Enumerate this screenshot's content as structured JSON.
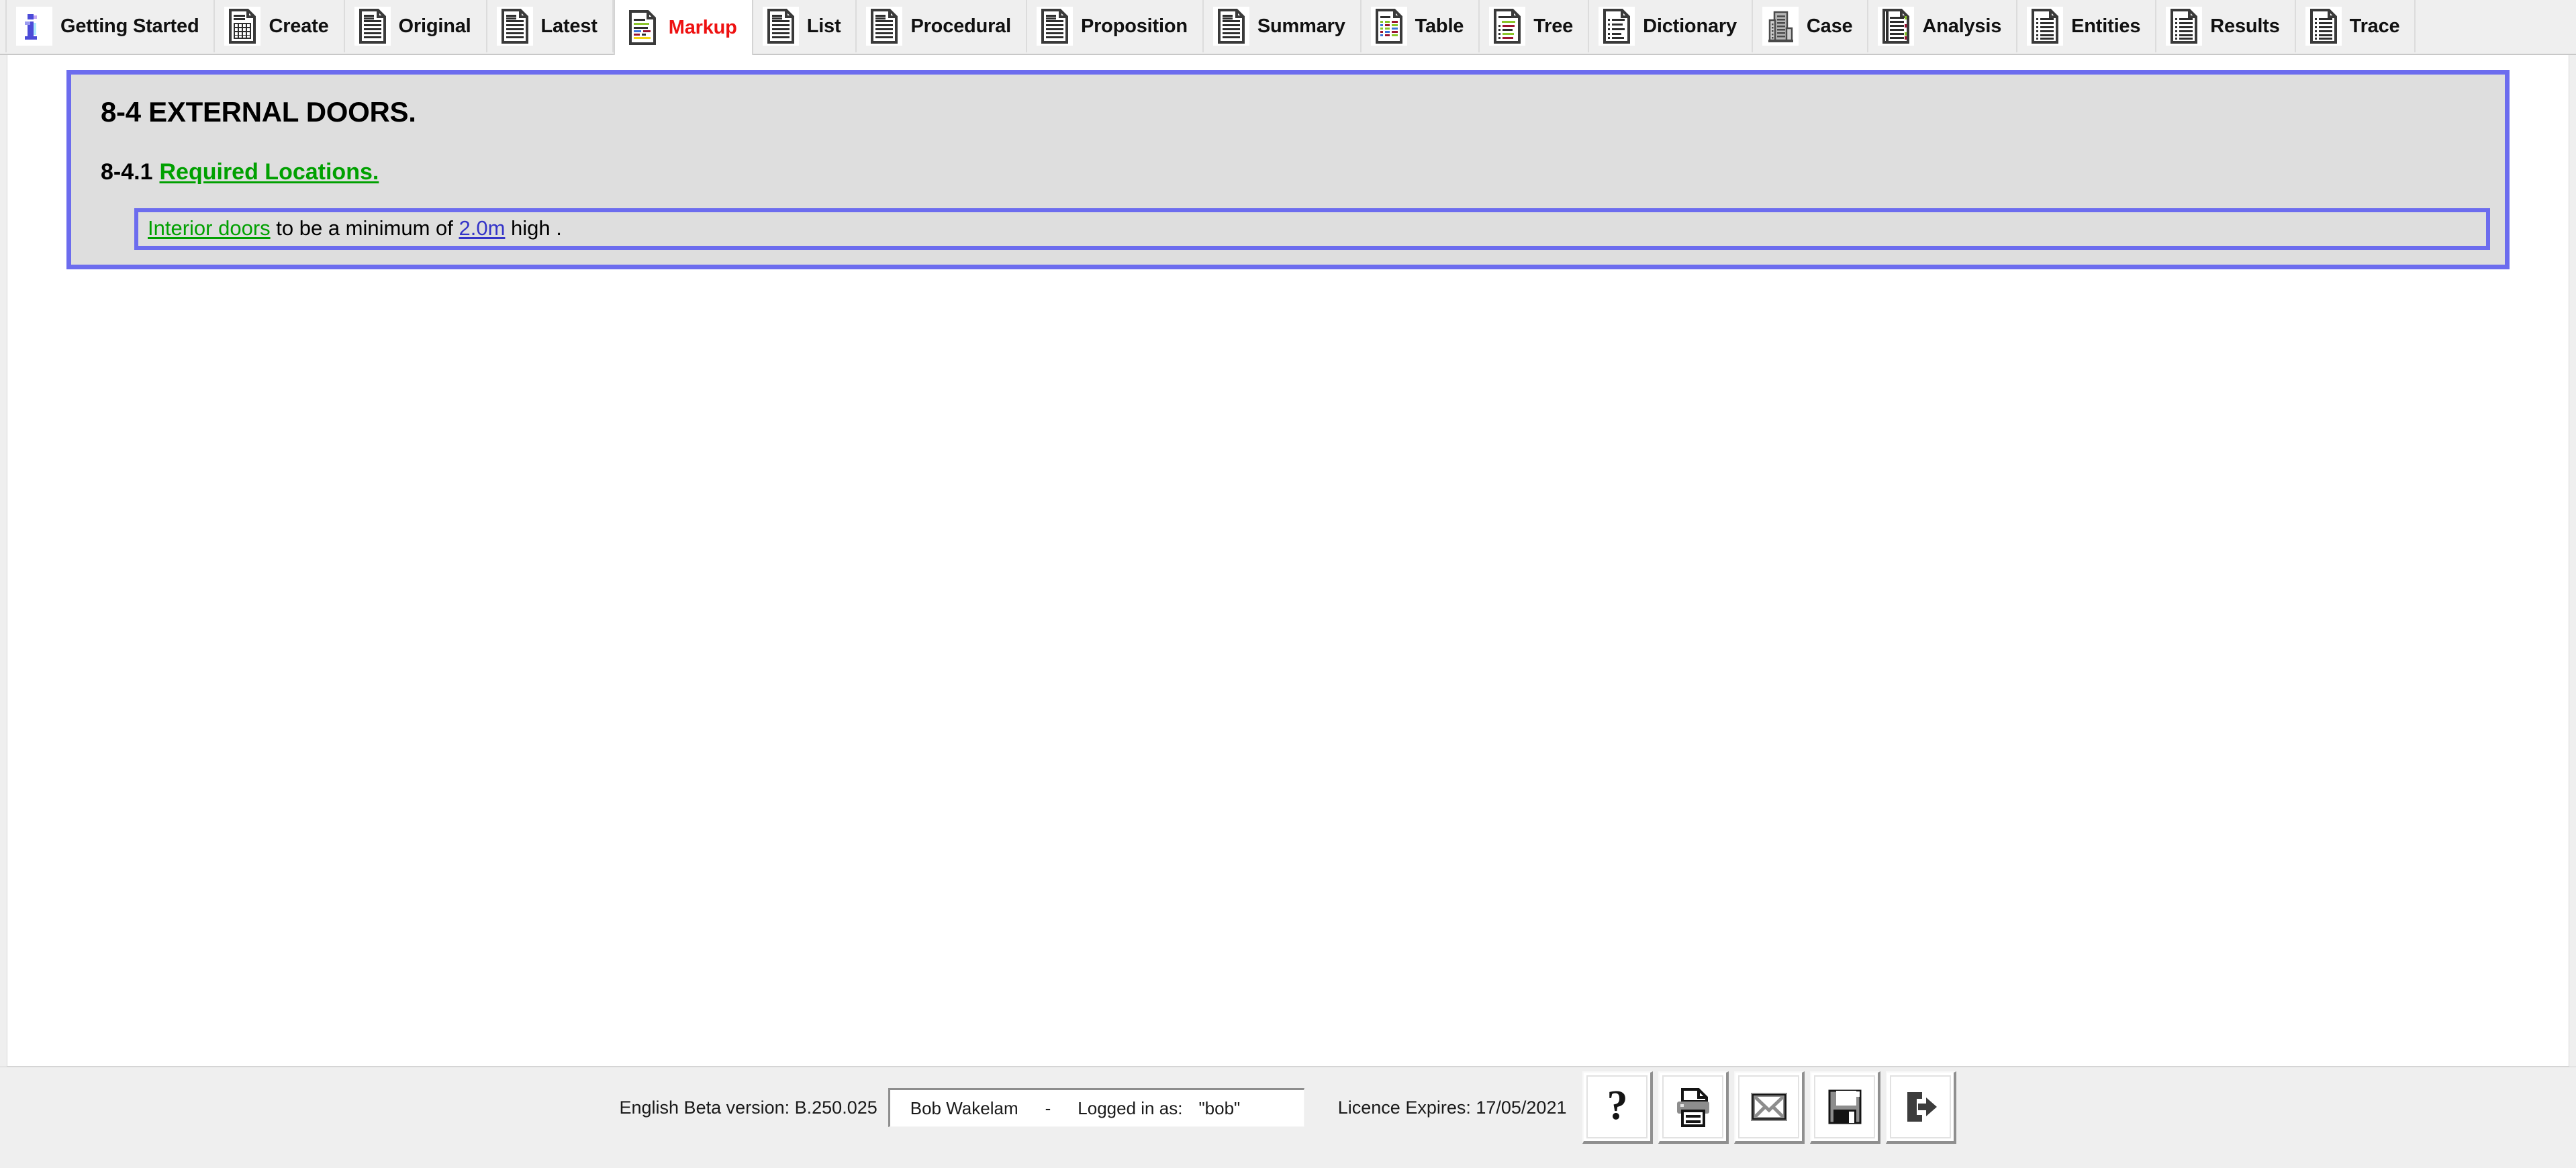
{
  "tabs": [
    {
      "label": "Getting Started",
      "icon": "info-icon",
      "active": false
    },
    {
      "label": "Create",
      "icon": "grid-doc-icon",
      "active": false
    },
    {
      "label": "Original",
      "icon": "doc-lines-icon",
      "active": false
    },
    {
      "label": "Latest",
      "icon": "doc-lines-icon",
      "active": false
    },
    {
      "label": "Markup",
      "icon": "doc-color-icon",
      "active": true
    },
    {
      "label": "List",
      "icon": "doc-lines-icon",
      "active": false
    },
    {
      "label": "Procedural",
      "icon": "doc-lines-icon",
      "active": false
    },
    {
      "label": "Proposition",
      "icon": "doc-lines-icon",
      "active": false
    },
    {
      "label": "Summary",
      "icon": "doc-lines-icon",
      "active": false
    },
    {
      "label": "Table",
      "icon": "doc-table-icon",
      "active": false
    },
    {
      "label": "Tree",
      "icon": "doc-tree-icon",
      "active": false
    },
    {
      "label": "Dictionary",
      "icon": "doc-dict-icon",
      "active": false
    },
    {
      "label": "Case",
      "icon": "building-icon",
      "active": false
    },
    {
      "label": "Analysis",
      "icon": "doc-analysis-icon",
      "active": false
    },
    {
      "label": "Entities",
      "icon": "doc-list-icon",
      "active": false
    },
    {
      "label": "Results",
      "icon": "doc-list-icon",
      "active": false
    },
    {
      "label": "Trace",
      "icon": "doc-list-icon",
      "active": false
    }
  ],
  "document": {
    "heading": "8-4 EXTERNAL DOORS.",
    "clause_ref": "8-4.1",
    "clause_title": "Required Locations.",
    "statement": {
      "term1": "Interior doors",
      "mid": " to be a minimum of ",
      "value": "2.0m",
      "tail": " high ."
    }
  },
  "colors": {
    "panel_border": "#6C6CEE",
    "panel_bg": "#DEDEDE",
    "link_green": "#00A000",
    "link_blue": "#3434C8",
    "active_tab_text": "#EE1111"
  },
  "footer": {
    "version": "English Beta version: B.250.025",
    "user_name": "Bob Wakelam",
    "separator": "-",
    "logged_in_label": "Logged in as:",
    "logged_in_user": "\"bob\"",
    "licence": "Licence Expires: 17/05/2021",
    "buttons": [
      {
        "name": "help-button",
        "icon": "question-mark-icon"
      },
      {
        "name": "print-button",
        "icon": "printer-icon"
      },
      {
        "name": "email-button",
        "icon": "envelope-icon"
      },
      {
        "name": "save-button",
        "icon": "floppy-disk-icon"
      },
      {
        "name": "exit-button",
        "icon": "exit-arrow-icon"
      }
    ]
  }
}
